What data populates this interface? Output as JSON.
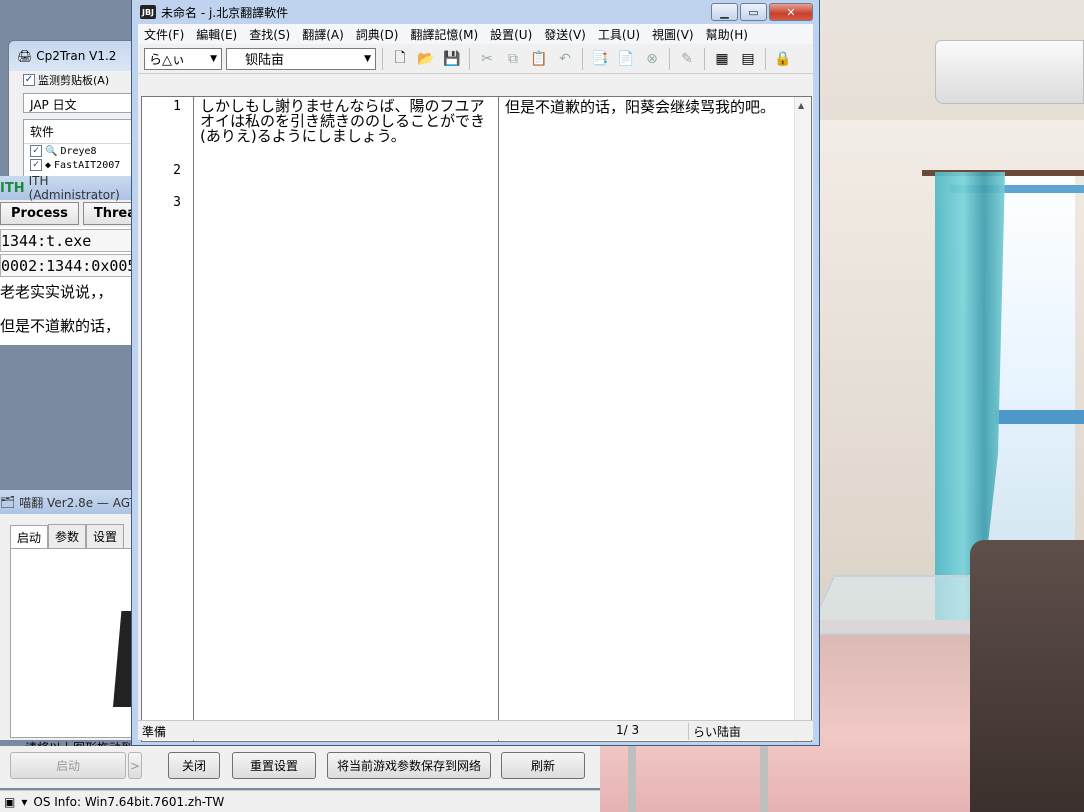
{
  "main_window": {
    "title": "未命名 - j.北京翻譯軟件",
    "app_icon": "J-BEIJING",
    "menu": [
      "文件(F)",
      "編輯(E)",
      "查找(S)",
      "翻譯(A)",
      "詞典(D)",
      "翻譯記憶(M)",
      "設置(U)",
      "發送(V)",
      "工具(U)",
      "視圖(V)",
      "幫助(H)"
    ],
    "toolbar": {
      "mode_dropdown": "ら△ぃ",
      "dict_dropdown": "钡陆亩",
      "icons": [
        "new-file-icon",
        "open-folder-icon",
        "save-icon",
        "cut-icon",
        "copy-icon",
        "paste-icon",
        "undo-icon",
        "translate-doc-icon",
        "translate-selection-icon",
        "stop-icon",
        "dictionary-icon",
        "memory-icon",
        "export-icon",
        "lock-icon"
      ]
    },
    "lines": [
      {
        "number": "1",
        "source": "しかしもし謝りませんならば、陽のフユアオイは私のを引き続きののしることができ(ありえ)るようにしましょう。",
        "target": "但是不道歉的话，阳葵会继续骂我的吧。"
      },
      {
        "number": "2",
        "source": "",
        "target": ""
      },
      {
        "number": "3",
        "source": "",
        "target": ""
      }
    ],
    "status": {
      "ready": "準備",
      "position": "1/  3",
      "dictionary": "らい陆亩"
    }
  },
  "cp2tran": {
    "title": "Cp2Tran V1.2",
    "monitor_clipboard": "监测剪贴板(A)",
    "language": "JAP 日文",
    "list_header": "软件",
    "software": [
      "Dreye8",
      "FastAIT2007"
    ]
  },
  "ith": {
    "title": "ITH (Administrator)",
    "logo": "ITH",
    "buttons": [
      "Process",
      "Threa"
    ],
    "process": "1344:t.exe",
    "thread": "0002:1344:0x005",
    "text_lines": [
      "老老实实说说，，",
      "但是不道歉的话，"
    ]
  },
  "agth": {
    "title": "喵翻 Ver2.8e — AGT",
    "tabs": [
      "启动",
      "参数",
      "设置"
    ],
    "hint": "请将以上图形拖动到"
  },
  "bottom_controls": {
    "start": "启动",
    "arrow": ">",
    "close": "关闭",
    "reset": "重置设置",
    "save_params": "将当前游戏参数保存到网络",
    "refresh": "刷新"
  },
  "os_info": "OS Info: Win7.64bit.7601.zh-TW"
}
